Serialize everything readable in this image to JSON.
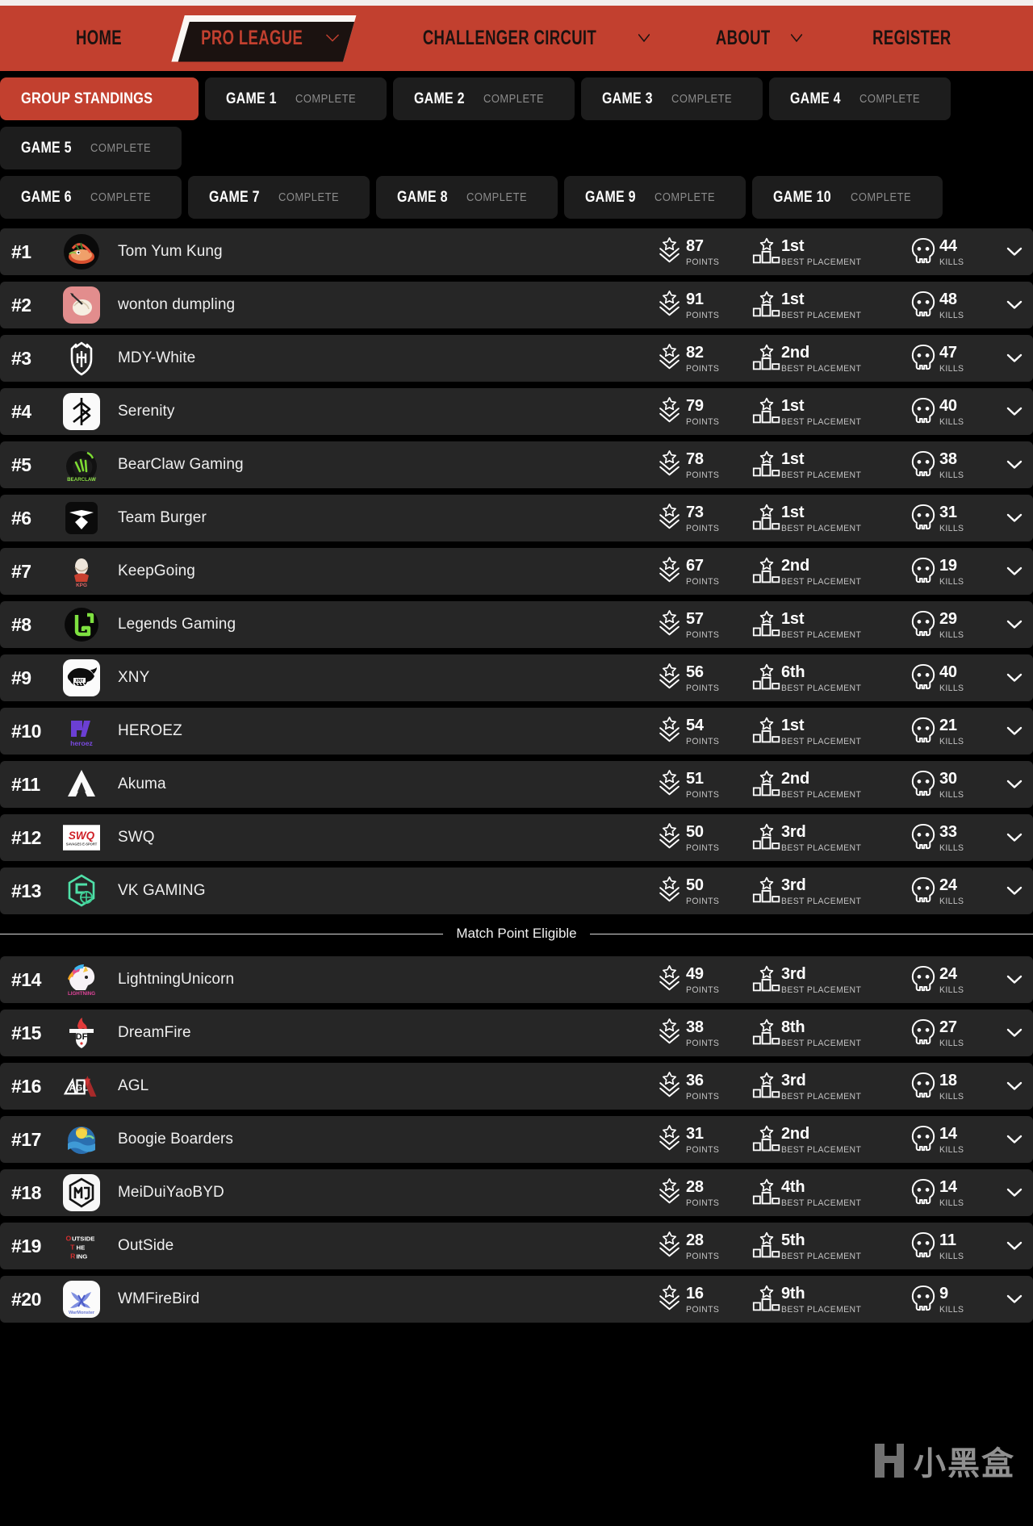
{
  "brand": {
    "accent": "#c2402f",
    "row_bg": "#262626",
    "page_bg": "#000000"
  },
  "nav": {
    "items": [
      {
        "label": "HOME",
        "has_caret": false,
        "active": false
      },
      {
        "label": "PRO LEAGUE",
        "has_caret": true,
        "active": true
      },
      {
        "label": "CHALLENGER CIRCUIT",
        "has_caret": true,
        "active": false
      },
      {
        "label": "ABOUT",
        "has_caret": true,
        "active": false
      },
      {
        "label": "REGISTER",
        "has_caret": false,
        "active": false
      }
    ]
  },
  "tabs": {
    "row1": [
      {
        "label": "GROUP STANDINGS",
        "status": "",
        "active": true
      },
      {
        "label": "GAME 1",
        "status": "COMPLETE",
        "active": false
      },
      {
        "label": "GAME 2",
        "status": "COMPLETE",
        "active": false
      },
      {
        "label": "GAME 3",
        "status": "COMPLETE",
        "active": false
      },
      {
        "label": "GAME 4",
        "status": "COMPLETE",
        "active": false
      },
      {
        "label": "GAME 5",
        "status": "COMPLETE",
        "active": false
      }
    ],
    "row2": [
      {
        "label": "GAME 6",
        "status": "COMPLETE",
        "active": false
      },
      {
        "label": "GAME 7",
        "status": "COMPLETE",
        "active": false
      },
      {
        "label": "GAME 8",
        "status": "COMPLETE",
        "active": false
      },
      {
        "label": "GAME 9",
        "status": "COMPLETE",
        "active": false
      },
      {
        "label": "GAME 10",
        "status": "COMPLETE",
        "active": false
      }
    ]
  },
  "stat_labels": {
    "points": "POINTS",
    "placement": "BEST PLACEMENT",
    "kills": "KILLS"
  },
  "icons": {
    "points": "rank-chevron-star-icon",
    "placement": "podium-star-icon",
    "kills": "skull-icon",
    "expand": "chevron-down-icon"
  },
  "divider": {
    "label": "Match Point Eligible",
    "after_rank": 13
  },
  "watermark": {
    "text": "小黑盒"
  },
  "standings": [
    {
      "rank": "#1",
      "team": "Tom Yum Kung",
      "points": "87",
      "placement": "1st",
      "kills": "44",
      "logo": "tom-yum-kung"
    },
    {
      "rank": "#2",
      "team": "wonton dumpling",
      "points": "91",
      "placement": "1st",
      "kills": "48",
      "logo": "wonton-dumpling"
    },
    {
      "rank": "#3",
      "team": "MDY-White",
      "points": "82",
      "placement": "2nd",
      "kills": "47",
      "logo": "mdy-white"
    },
    {
      "rank": "#4",
      "team": "Serenity",
      "points": "79",
      "placement": "1st",
      "kills": "40",
      "logo": "serenity"
    },
    {
      "rank": "#5",
      "team": "BearClaw Gaming",
      "points": "78",
      "placement": "1st",
      "kills": "38",
      "logo": "bearclaw"
    },
    {
      "rank": "#6",
      "team": "Team Burger",
      "points": "73",
      "placement": "1st",
      "kills": "31",
      "logo": "team-burger"
    },
    {
      "rank": "#7",
      "team": "KeepGoing",
      "points": "67",
      "placement": "2nd",
      "kills": "19",
      "logo": "keepgoing"
    },
    {
      "rank": "#8",
      "team": "Legends Gaming",
      "points": "57",
      "placement": "1st",
      "kills": "29",
      "logo": "legends-gaming"
    },
    {
      "rank": "#9",
      "team": "XNY",
      "points": "56",
      "placement": "6th",
      "kills": "40",
      "logo": "xny"
    },
    {
      "rank": "#10",
      "team": "HEROEZ",
      "points": "54",
      "placement": "1st",
      "kills": "21",
      "logo": "heroez"
    },
    {
      "rank": "#11",
      "team": "Akuma",
      "points": "51",
      "placement": "2nd",
      "kills": "30",
      "logo": "akuma"
    },
    {
      "rank": "#12",
      "team": "SWQ",
      "points": "50",
      "placement": "3rd",
      "kills": "33",
      "logo": "swq"
    },
    {
      "rank": "#13",
      "team": "VK GAMING",
      "points": "50",
      "placement": "3rd",
      "kills": "24",
      "logo": "vk-gaming"
    },
    {
      "rank": "#14",
      "team": "LightningUnicorn",
      "points": "49",
      "placement": "3rd",
      "kills": "24",
      "logo": "lightning-unicorn"
    },
    {
      "rank": "#15",
      "team": "DreamFire",
      "points": "38",
      "placement": "8th",
      "kills": "27",
      "logo": "dreamfire"
    },
    {
      "rank": "#16",
      "team": "AGL",
      "points": "36",
      "placement": "3rd",
      "kills": "18",
      "logo": "agl"
    },
    {
      "rank": "#17",
      "team": "Boogie Boarders",
      "points": "31",
      "placement": "2nd",
      "kills": "14",
      "logo": "boogie-boarders"
    },
    {
      "rank": "#18",
      "team": "MeiDuiYaoBYD",
      "points": "28",
      "placement": "4th",
      "kills": "14",
      "logo": "meiduiyaobyd"
    },
    {
      "rank": "#19",
      "team": "OutSide",
      "points": "28",
      "placement": "5th",
      "kills": "11",
      "logo": "outside"
    },
    {
      "rank": "#20",
      "team": "WMFireBird",
      "points": "16",
      "placement": "9th",
      "kills": "9",
      "logo": "wmfirebird"
    }
  ]
}
